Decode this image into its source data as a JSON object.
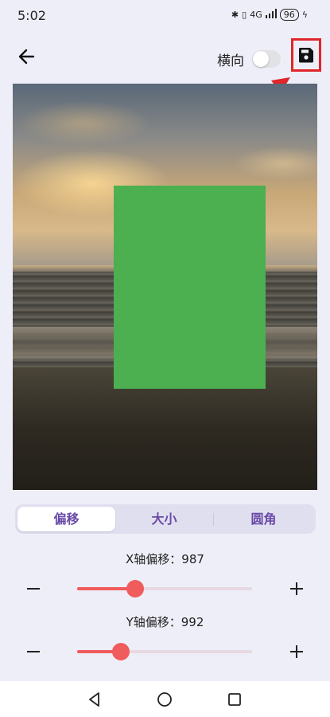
{
  "status_bar": {
    "time": "5:02",
    "network": "4G",
    "battery": "96"
  },
  "toolbar": {
    "orientation_label": "横向",
    "orientation_on": false
  },
  "tabs": [
    {
      "label": "偏移",
      "active": true
    },
    {
      "label": "大小",
      "active": false
    },
    {
      "label": "圆角",
      "active": false
    }
  ],
  "sliders": [
    {
      "label": "X轴偏移：987",
      "value_fraction": 0.33
    },
    {
      "label": "Y轴偏移：992",
      "value_fraction": 0.25
    }
  ],
  "colors": {
    "accent": "#f05b5b",
    "tab_text": "#6a4aa8",
    "overlay_rect": "#4caf50",
    "annotation": "#e0262a"
  }
}
